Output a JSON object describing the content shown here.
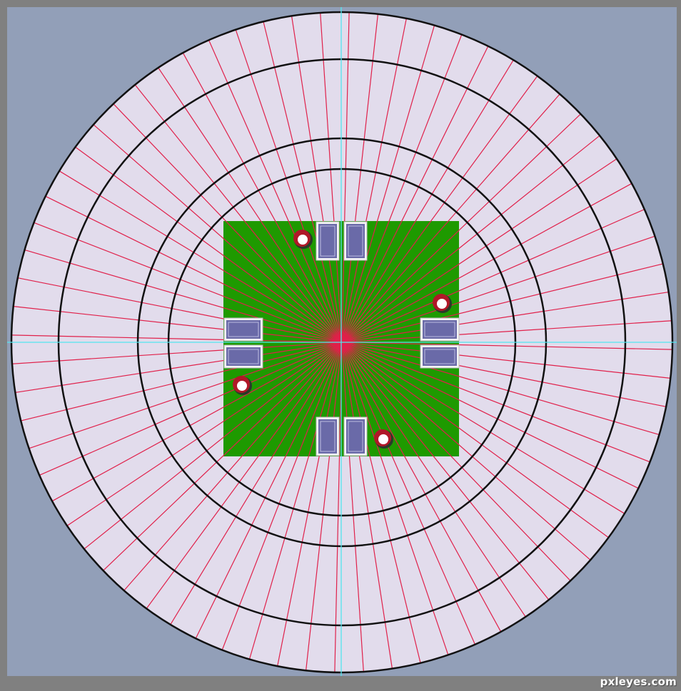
{
  "watermark": "pxleyes.com",
  "colors": {
    "border": "#808080",
    "canvas": "#929fb8",
    "ring_fill": "#e2dcec",
    "ring_stroke": "#111111",
    "spoke": "#e0204a",
    "felt": "#1e9a00",
    "guide": "#52e6ee",
    "card_back": "#6a6aa8",
    "card_edge": "#f4f4f4",
    "chip_red": "#b01828",
    "chip_white": "#ffffff"
  },
  "guides": [
    "vertical-guide",
    "horizontal-guide"
  ],
  "rings": [
    "outer-ring",
    "ring-2",
    "ring-3",
    "inner-ring"
  ],
  "spoke_count": 72,
  "cards": [
    {
      "side": "top",
      "slot": 1
    },
    {
      "side": "top",
      "slot": 2
    },
    {
      "side": "bottom",
      "slot": 1
    },
    {
      "side": "bottom",
      "slot": 2
    },
    {
      "side": "left",
      "slot": 1
    },
    {
      "side": "left",
      "slot": 2
    },
    {
      "side": "right",
      "slot": 1
    },
    {
      "side": "right",
      "slot": 2
    }
  ],
  "chips": [
    {
      "position": "top-left"
    },
    {
      "position": "right-upper"
    },
    {
      "position": "left-lower"
    },
    {
      "position": "bottom-right"
    }
  ]
}
